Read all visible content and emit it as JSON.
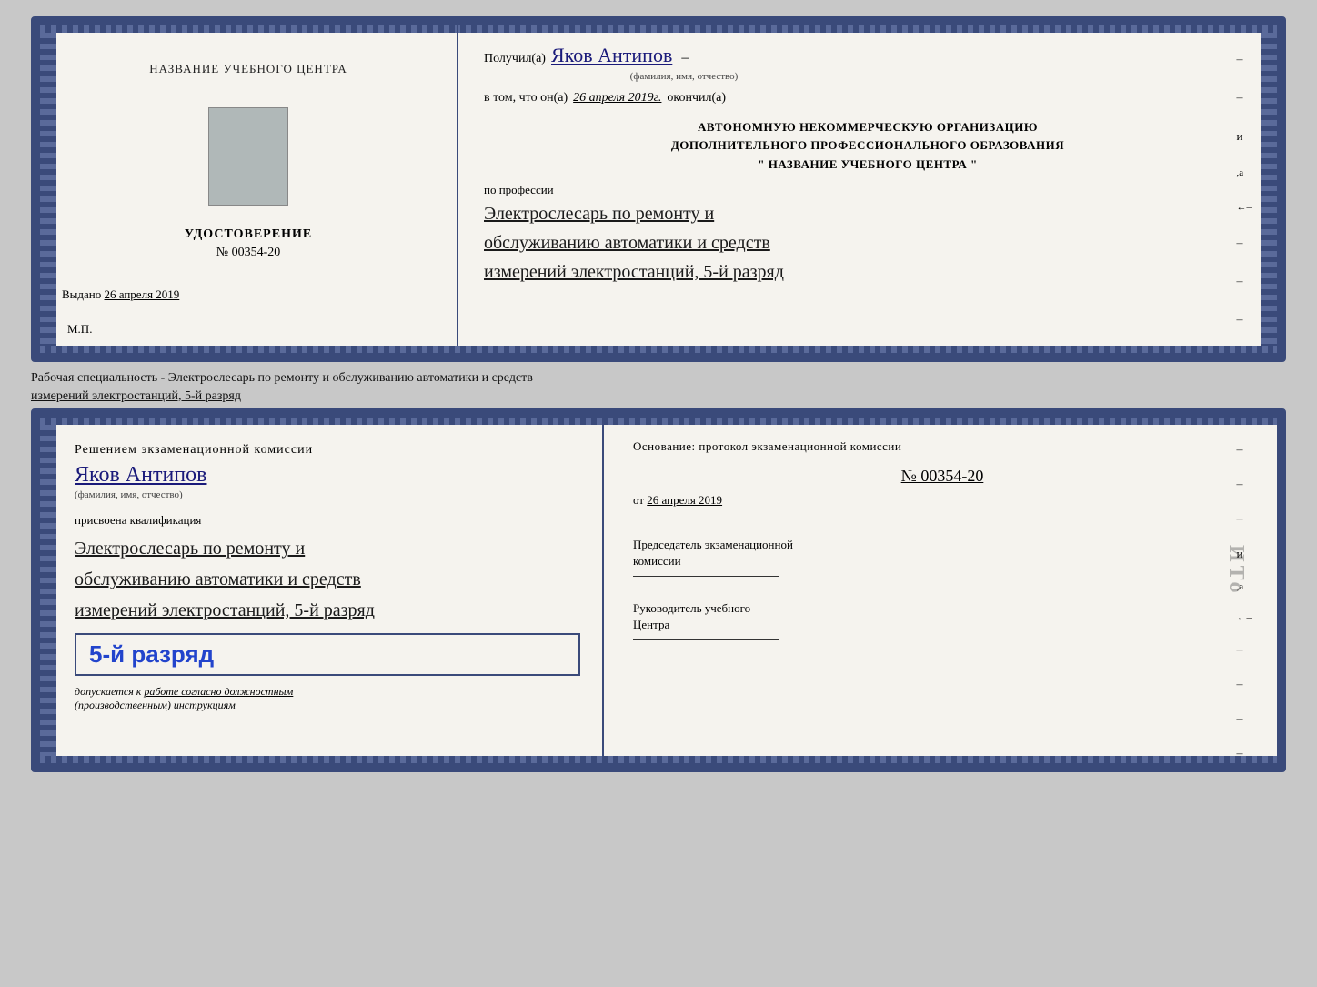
{
  "top_doc": {
    "left": {
      "center_title": "НАЗВАНИЕ УЧЕБНОГО ЦЕНТРА",
      "cert_title": "УДОСТОВЕРЕНИЕ",
      "cert_number": "№ 00354-20",
      "issued_label": "Выдано",
      "issued_date": "26 апреля 2019",
      "mp_label": "М.П."
    },
    "right": {
      "received_label": "Получил(а)",
      "recipient_name": "Яков Антипов",
      "fio_sub": "(фамилия, имя, отчество)",
      "confirm_label": "в том, что он(а)",
      "confirm_date": "26 апреля 2019г.",
      "finished_label": "окончил(а)",
      "org_line1": "АВТОНОМНУЮ НЕКОММЕРЧЕСКУЮ ОРГАНИЗАЦИЮ",
      "org_line2": "ДОПОЛНИТЕЛЬНОГО ПРОФЕССИОНАЛЬНОГО ОБРАЗОВАНИЯ",
      "org_name": "\"   НАЗВАНИЕ УЧЕБНОГО ЦЕНТРА   \"",
      "profession_label": "по профессии",
      "profession_hw1": "Электрослесарь по ремонту и",
      "profession_hw2": "обслуживанию автоматики и средств",
      "profession_hw3": "измерений электростанций, 5-й разряд"
    }
  },
  "separator": {
    "text_line1": "Рабочая специальность - Электрослесарь по ремонту и обслуживанию автоматики и средств",
    "text_line2": "измерений электростанций, 5-й разряд"
  },
  "bottom_doc": {
    "left": {
      "decision_title": "Решением экзаменационной комиссии",
      "name_hw": "Яков Антипов",
      "fio_sub": "(фамилия, имя, отчество)",
      "assigned_text": "присвоена квалификация",
      "qual_hw1": "Электрослесарь по ремонту и",
      "qual_hw2": "обслуживанию автоматики и средств",
      "qual_hw3": "измерений электростанций, 5-й разряд",
      "grade_text": "5-й разряд",
      "allowed_prefix": "допускается к",
      "allowed_underline": "работе согласно должностным",
      "allowed_italic": "(производственным) инструкциям"
    },
    "right": {
      "basis_text": "Основание: протокол экзаменационной комиссии",
      "protocol_number": "№ 00354-20",
      "date_prefix": "от",
      "date_val": "26 апреля 2019",
      "chairman_title_line1": "Председатель экзаменационной",
      "chairman_title_line2": "комиссии",
      "director_title_line1": "Руководитель учебного",
      "director_title_line2": "Центра",
      "ito_mark": "ИTo"
    }
  }
}
